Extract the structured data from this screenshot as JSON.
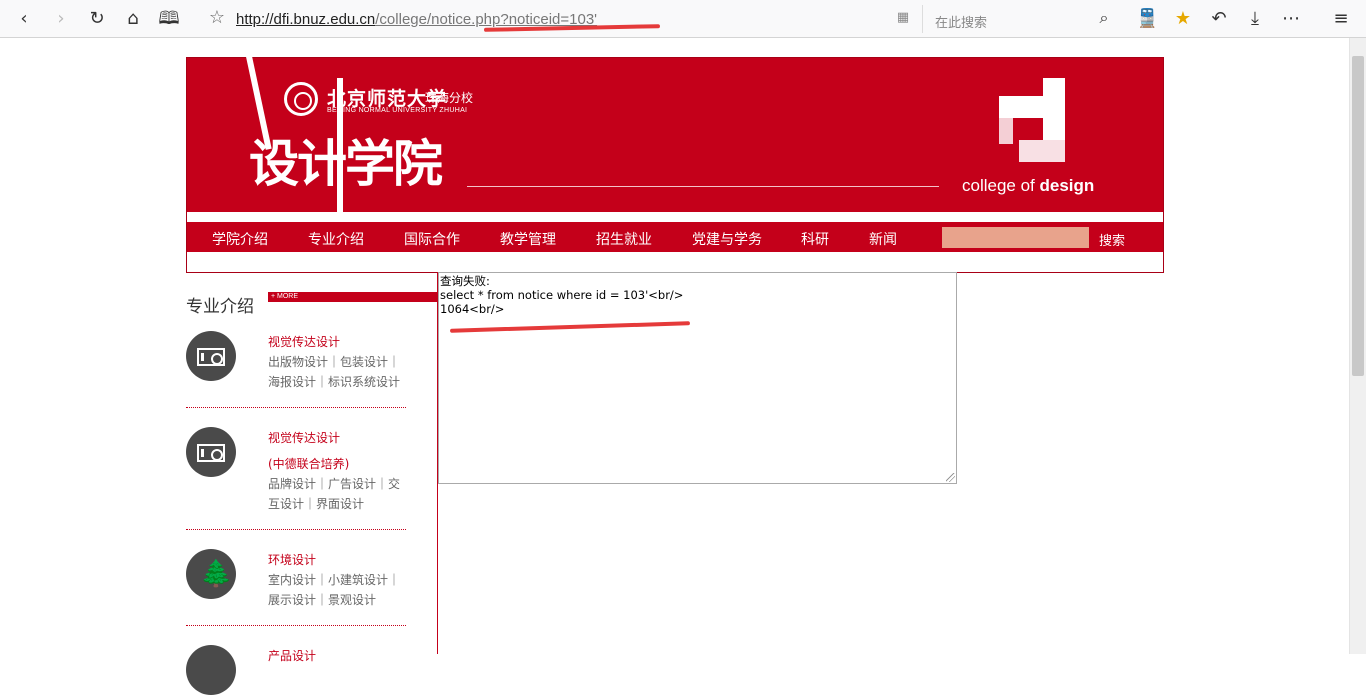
{
  "browser": {
    "url_host": "http://dfi.bnuz.edu.cn",
    "url_path": "/college/notice.php?noticeid=103'",
    "search_placeholder": "在此搜索"
  },
  "header": {
    "university_name": "北京师范大学",
    "university_campus": "珠海分校",
    "university_en": "BEIJING NORMAL UNIVERSITY  ZHUHAI",
    "college_cn": "设计学院",
    "college_en_prefix": "college of ",
    "college_en_bold": "design"
  },
  "nav": {
    "items": [
      "学院介绍",
      "专业介绍",
      "国际合作",
      "教学管理",
      "招生就业",
      "党建与学务",
      "科研",
      "新闻"
    ],
    "search_button": "搜索"
  },
  "sidebar": {
    "title": "专业介绍",
    "more": "+ MORE",
    "categories": [
      {
        "title": "视觉传达设计",
        "subtitle": "",
        "items": "出版物设计｜包装设计｜海报设计｜标识系统设计",
        "icon": "camera-icon"
      },
      {
        "title": "视觉传达设计",
        "subtitle": "(中德联合培养)",
        "items": "品牌设计｜广告设计｜交互设计｜界面设计",
        "icon": "camera-icon"
      },
      {
        "title": "环境设计",
        "subtitle": "",
        "items": "室内设计｜小建筑设计｜展示设计｜景观设计",
        "icon": "tree-icon"
      },
      {
        "title": "产品设计",
        "subtitle": "",
        "items": "",
        "icon": "product-icon"
      }
    ]
  },
  "result": {
    "line1": "查询失败:",
    "line2": "select * from notice where id = 103'<br/>",
    "line3": "1064<br/>"
  },
  "colors": {
    "brand_red": "#c4001a",
    "annotation_red": "#e53a3a"
  }
}
